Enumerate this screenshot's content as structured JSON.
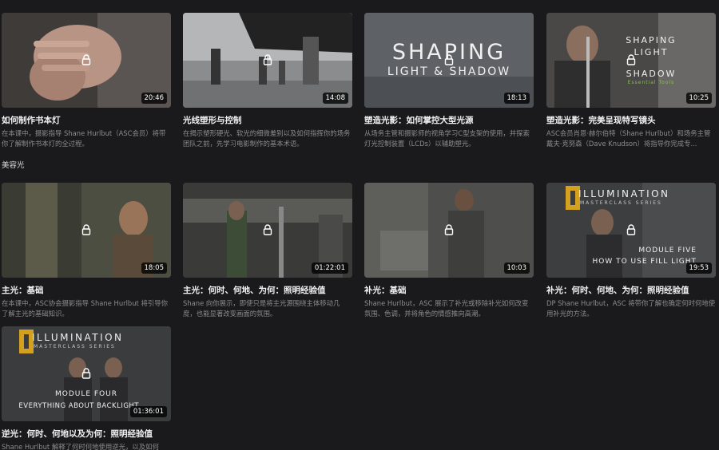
{
  "section_label": "美容光",
  "cards": [
    {
      "title": "如何制作书本灯",
      "desc": "在本课中，摄影指导 Shane Hurlbut（ASC会员）将带你了解制作书本灯的全过程。",
      "duration": "20:46"
    },
    {
      "title": "光线塑形与控制",
      "desc": "在揭示塑形硬光、软光的细微差别以及如何指挥你的场务团队之前，先学习电影制作的基本术语。",
      "duration": "14:08"
    },
    {
      "title": "塑造光影：如何掌控大型光源",
      "desc": "从场务主管和摄影师的视角学习C型支架的使用，并探索灯光控制装置（LCDs）以辅助塑光。",
      "duration": "18:13",
      "overlay1": "SHAPING",
      "overlay2": "LIGHT & SHADOW"
    },
    {
      "title": "塑造光影：完美呈现特写镜头",
      "desc": "ASC会员肖恩·赫尔伯特（Shane Hurlbut）和场务主管戴夫·克努森（Dave Knudson）将指导你完成专...",
      "duration": "10:25",
      "overlay1": "SHAPING",
      "overlay2": "LIGHT",
      "overlay3": "SHADOW",
      "overlay4": "Essential Tools"
    },
    {
      "title": "主光：基础",
      "desc": "在本课中，ASC协会摄影指导 Shane Hurlbut 将引导你了解主光的基础知识。",
      "duration": "18:05"
    },
    {
      "title": "主光：何时、何地、为何：照明经验值",
      "desc": "Shane 向你展示，即使只是将主光源围绕主体移动几度，也能显著改变画面的氛围。",
      "duration": "01:22:01"
    },
    {
      "title": "补光：基础",
      "desc": "Shane Hurlbut，ASC 展示了补光或移除补光如何改变氛围、色调，并将角色的情感推向高潮。",
      "duration": "10:03"
    },
    {
      "title": "补光：何时、何地、为何：照明经验值",
      "desc": "DP Shane Hurlbut，ASC 将带你了解也确定何时何地使用补光的方法。",
      "duration": "19:53",
      "brand": "ILLUMINATION",
      "brand_sub": "MASTERCLASS SERIES",
      "module1": "MODULE FIVE",
      "module2": "HOW TO USE FILL LIGHT"
    },
    {
      "title": "逆光：何时、何地以及为何：照明经验值",
      "desc": "Shane Hurlbut 解释了何时何地使用逆光，以及如何",
      "duration": "01:36:01",
      "brand": "ILLUMINATION",
      "brand_sub": "MASTERCLASS SERIES",
      "module1": "MODULE FOUR",
      "module2": "EVERYTHING ABOUT BACKLIGHT"
    }
  ]
}
